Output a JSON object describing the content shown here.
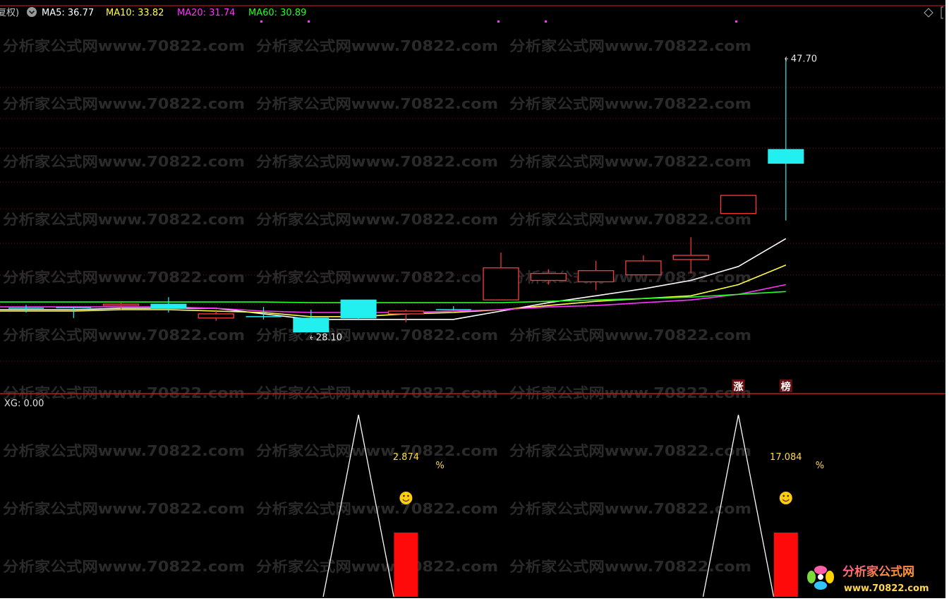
{
  "header": {
    "mode_label": "复权)",
    "ma_items": [
      {
        "name": "MA5",
        "value": "36.77",
        "text": "MA5: 36.77",
        "color": "#ffffff"
      },
      {
        "name": "MA10",
        "value": "33.82",
        "text": "MA10: 33.82",
        "color": "#ffff4a"
      },
      {
        "name": "MA20",
        "value": "31.74",
        "text": "MA20: 31.74",
        "color": "#ff33ff"
      },
      {
        "name": "MA60",
        "value": "30.89",
        "text": "MA60: 30.89",
        "color": "#22ff22"
      }
    ]
  },
  "indicator": {
    "label": "XG: 0.00"
  },
  "watermark": {
    "text": "分析家公式网www.70822.com"
  },
  "logo": {
    "title": "分析家公式网",
    "url": "www.70822.com"
  },
  "colors": {
    "background": "#000000",
    "up": "#ff3a3a",
    "down": "#22f0f0",
    "divider": "#b01818",
    "label_yellow": "#ffd84a"
  },
  "chart_data": [
    {
      "type": "candlestick",
      "title": "",
      "ylim": [
        25.6,
        50.0
      ],
      "candles": [
        {
          "open": 29.8,
          "close": 29.8,
          "high": 30.05,
          "low": 29.5,
          "dir": "flat"
        },
        {
          "open": 29.85,
          "close": 29.85,
          "high": 29.9,
          "low": 29.1,
          "dir": "flat"
        },
        {
          "open": 30.0,
          "close": 30.1,
          "high": 30.2,
          "low": 29.7,
          "dir": "up"
        },
        {
          "open": 30.1,
          "close": 29.8,
          "high": 30.6,
          "low": 29.5,
          "dir": "down"
        },
        {
          "open": 29.1,
          "close": 29.4,
          "high": 29.7,
          "low": 28.9,
          "dir": "up"
        },
        {
          "open": 29.2,
          "close": 29.2,
          "high": 29.9,
          "low": 29.0,
          "dir": "flat"
        },
        {
          "open": 29.1,
          "close": 28.1,
          "high": 29.7,
          "low": 28.1,
          "dir": "down",
          "label": "28.10"
        },
        {
          "open": 30.4,
          "close": 29.1,
          "high": 30.4,
          "low": 29.0,
          "dir": "down"
        },
        {
          "open": 29.4,
          "close": 29.6,
          "high": 29.7,
          "low": 28.8,
          "dir": "up"
        },
        {
          "open": 29.7,
          "close": 29.7,
          "high": 29.95,
          "low": 29.65,
          "dir": "flat"
        },
        {
          "open": 30.4,
          "close": 32.7,
          "high": 33.8,
          "low": 30.4,
          "dir": "up"
        },
        {
          "open": 31.8,
          "close": 32.3,
          "high": 32.6,
          "low": 31.5,
          "dir": "up"
        },
        {
          "open": 31.7,
          "close": 32.5,
          "high": 33.2,
          "low": 31.1,
          "dir": "up"
        },
        {
          "open": 32.2,
          "close": 33.2,
          "high": 33.6,
          "low": 32.2,
          "dir": "up"
        },
        {
          "open": 33.3,
          "close": 33.6,
          "high": 34.9,
          "low": 32.3,
          "dir": "up"
        },
        {
          "open": 36.6,
          "close": 37.9,
          "high": 37.9,
          "low": 36.6,
          "dir": "up"
        },
        {
          "open": 41.2,
          "close": 40.2,
          "high": 47.7,
          "low": 36.1,
          "dir": "down",
          "label": "47.70"
        }
      ],
      "series": [
        {
          "name": "MA5",
          "color": "#ffffff",
          "values": [
            29.7,
            29.7,
            29.8,
            29.8,
            29.8,
            29.4,
            29.0,
            29.0,
            29.0,
            29.0,
            29.6,
            30.2,
            30.7,
            31.2,
            31.8,
            32.8,
            34.8
          ]
        },
        {
          "name": "MA10",
          "color": "#ffff4a",
          "values": [
            29.6,
            29.6,
            29.7,
            29.7,
            29.6,
            29.5,
            29.2,
            29.2,
            29.4,
            29.5,
            29.7,
            30.0,
            30.3,
            30.5,
            30.7,
            31.5,
            32.9
          ]
        },
        {
          "name": "MA20",
          "color": "#ff33ff",
          "values": [
            29.9,
            29.9,
            29.9,
            29.9,
            29.8,
            29.6,
            29.5,
            29.5,
            29.5,
            29.6,
            29.7,
            29.9,
            30.0,
            30.2,
            30.4,
            30.8,
            31.5
          ]
        },
        {
          "name": "MA60",
          "color": "#22ff22",
          "values": [
            30.25,
            30.25,
            30.25,
            30.25,
            30.25,
            30.25,
            30.2,
            30.2,
            30.2,
            30.2,
            30.2,
            30.3,
            30.4,
            30.5,
            30.6,
            30.8,
            31.0
          ]
        }
      ],
      "markers": [
        {
          "index": 15,
          "text": "涨"
        },
        {
          "index": 16,
          "text": "榜"
        }
      ]
    },
    {
      "type": "indicator",
      "title": "XG: 0.00",
      "signals": [
        {
          "peak_index": 7,
          "bar_index": 8,
          "value": "2.874",
          "unit": "%"
        },
        {
          "peak_index": 15,
          "bar_index": 16,
          "value": "17.084",
          "unit": "%"
        }
      ]
    }
  ]
}
